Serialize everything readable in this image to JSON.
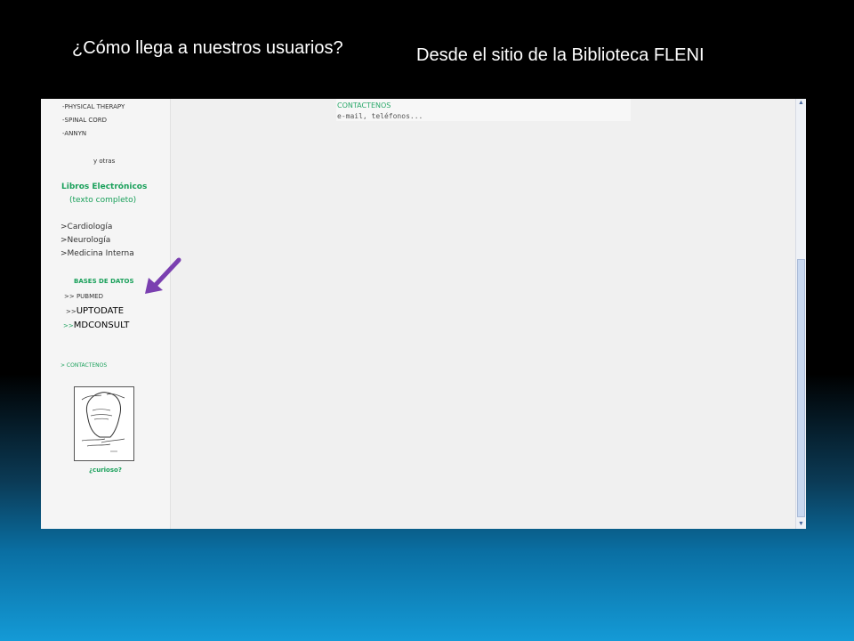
{
  "slide": {
    "title_left": "¿Cómo llega a nuestros usuarios?",
    "title_right": "Desde  el sitio de la Biblioteca  FLENI"
  },
  "sidebar": {
    "items_top": [
      "-PHYSICAL THERAPY",
      "-SPINAL CORD",
      "-ANNYN"
    ],
    "y_otras": "y otras",
    "ebooks_heading": "Libros Electrónicos",
    "ebooks_sub": "(texto completo)",
    "ebooks": [
      ">Cardiología",
      ">Neurología",
      ">Medicina Interna"
    ],
    "db_heading": "BASES  DE DATOS",
    "db_pubmed": ">> PUBMED",
    "db_uptodate_prefix": ">>",
    "db_uptodate": "UPTODATE",
    "db_mdconsult_prefix": ">>",
    "db_mdconsult": "MDCONSULT",
    "contact_link": "> CONTACTENOS",
    "curioso": "¿curioso?"
  },
  "main": {
    "contact_title": "CONTACTENOS",
    "contact_sub": "e-mail, teléfonos..."
  },
  "colors": {
    "accent_green": "#19a05a",
    "arrow_purple": "#7a3fb0"
  },
  "icons": {
    "arrow": "arrow-down-left-icon",
    "portrait": "sketch-head-image"
  }
}
